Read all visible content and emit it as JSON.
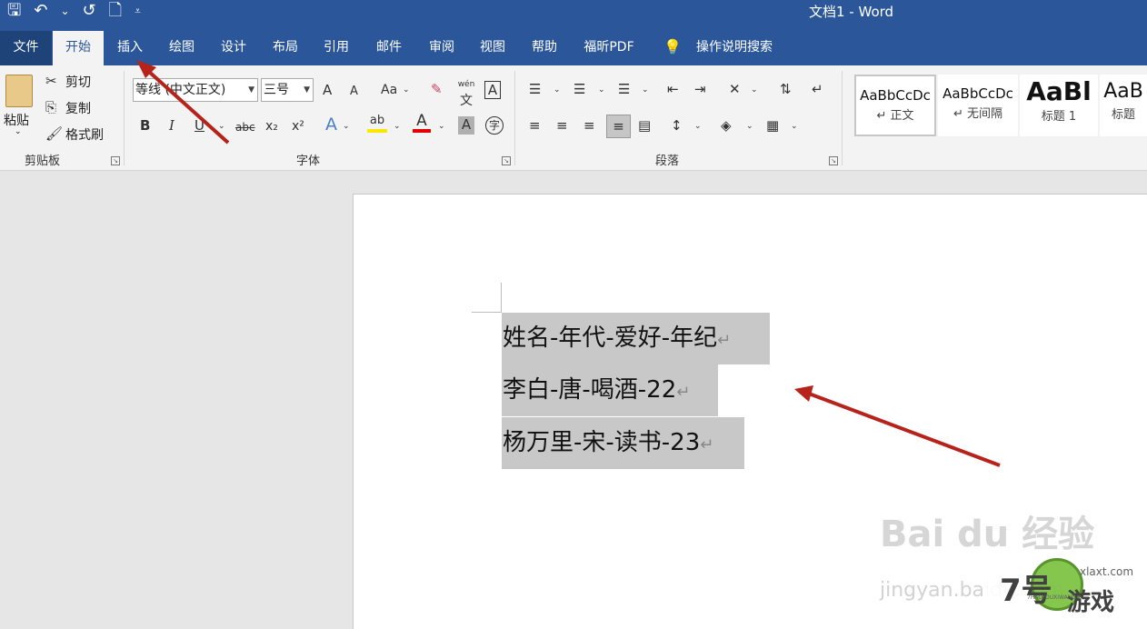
{
  "window": {
    "title": "文档1  -  Word"
  },
  "qat": {
    "save": "🖫",
    "undo": "↶",
    "undo_drop": "⌄",
    "redo": "↺",
    "new_doc": "🗋",
    "customize": "⩡"
  },
  "tabs": [
    "文件",
    "开始",
    "插入",
    "绘图",
    "设计",
    "布局",
    "引用",
    "邮件",
    "审阅",
    "视图",
    "帮助",
    "福昕PDF",
    "操作说明搜索"
  ],
  "clipboard": {
    "paste": "粘贴",
    "cut": "剪切",
    "copy": "复制",
    "format_painter": "格式刷",
    "group": "剪贴板"
  },
  "font": {
    "name": "等线 (中文正文)",
    "size": "三号",
    "group": "字体",
    "grow": "A",
    "shrink": "A",
    "case": "Aa",
    "bold": "B",
    "italic": "I",
    "underline": "U",
    "strike": "abc",
    "sub": "x₂",
    "sup": "x²",
    "font_color_letter": "A",
    "highlight_letter": "ab",
    "shade_letter": "A",
    "phonetic": "文",
    "phonetic_top": "wén",
    "border": "A",
    "enclose": "字"
  },
  "paragraph": {
    "group": "段落"
  },
  "styles": [
    {
      "preview": "AaBbCcDc",
      "name": "↵ 正文"
    },
    {
      "preview": "AaBbCcDc",
      "name": "↵ 无间隔"
    },
    {
      "preview": "AaBl",
      "name": "标题 1"
    },
    {
      "preview": "AaB",
      "name": "标题"
    }
  ],
  "document": {
    "lines": [
      "姓名-年代-爱好-年纪",
      "李白-唐-喝酒-22",
      "杨万里-宋-读书-23"
    ],
    "para_mark": "↵"
  },
  "watermark": {
    "text": "Bai du 经验",
    "sub": "jingyan.baidu.com"
  },
  "badge": {
    "num": "7号",
    "game": "游戏",
    "url": "xlaxt.com",
    "sub": "7HAOYOUXIWANG"
  },
  "colors": {
    "titlebar": "#2b579a",
    "highlight": "#c8c8c8",
    "arrow": "#b5231b"
  }
}
